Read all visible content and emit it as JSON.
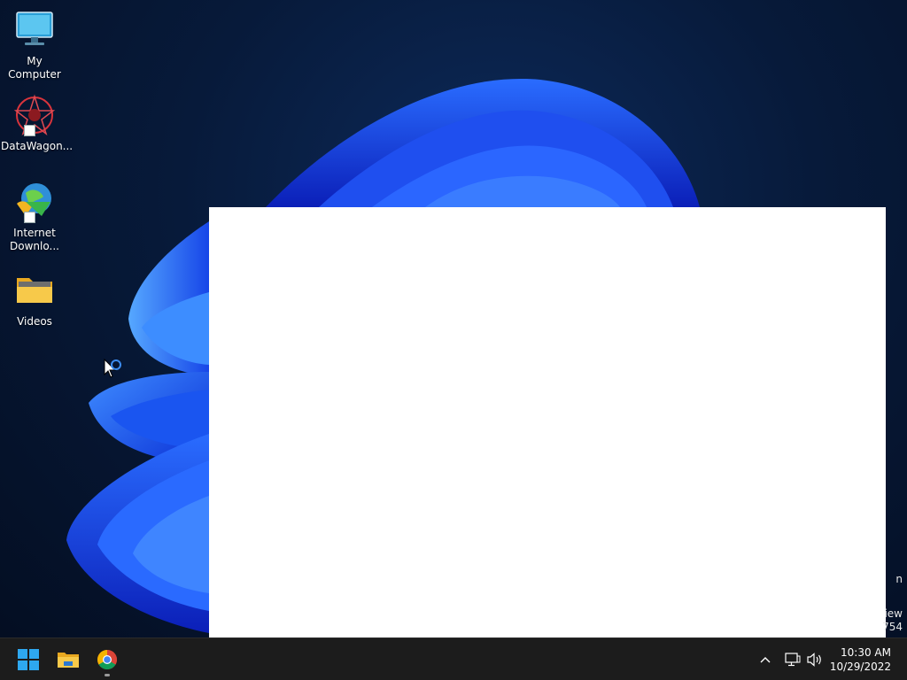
{
  "desktop": {
    "icons": [
      {
        "label": "My Computer",
        "icon": "monitor-icon"
      },
      {
        "label": "DataWagon...",
        "icon": "datawagon-icon"
      },
      {
        "label": "Internet Downlo...",
        "icon": "internet-download-manager-icon"
      },
      {
        "label": "Videos",
        "icon": "folder-icon"
      }
    ],
    "watermark": {
      "line1": "n",
      "line2": "iew",
      "line3": "754"
    }
  },
  "taskbar": {
    "buttons": [
      {
        "name": "start",
        "icon": "windows-logo-icon"
      },
      {
        "name": "file-explorer",
        "icon": "folder-icon"
      },
      {
        "name": "chrome",
        "icon": "chrome-icon"
      }
    ],
    "tray": {
      "chevron": "chevron-up-icon",
      "network": "network-icon",
      "volume": "volume-icon"
    },
    "clock": {
      "time": "10:30 AM",
      "date": "10/29/2022"
    }
  },
  "colors": {
    "taskbar_bg": "#1c1c1c",
    "wallpaper_dark": "#040e22",
    "bloom_blue": "#1f5cff"
  }
}
